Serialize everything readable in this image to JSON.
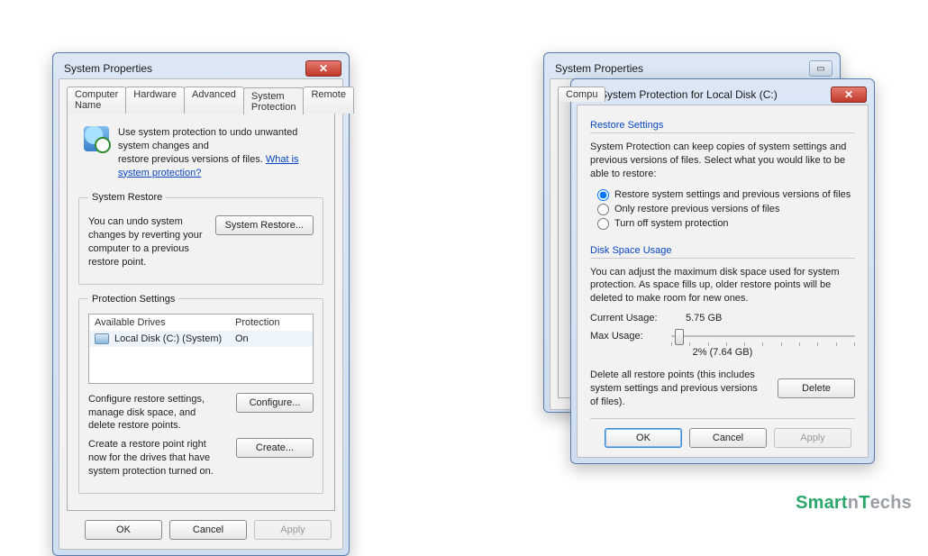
{
  "brand": {
    "part1": "Smart",
    "part2": "n",
    "part3": "T",
    "part4": "echs"
  },
  "win1": {
    "title": "System Properties",
    "tabs": [
      "Computer Name",
      "Hardware",
      "Advanced",
      "System Protection",
      "Remote"
    ],
    "activeTabIndex": 3,
    "intro_line1": "Use system protection to undo unwanted system changes and",
    "intro_line2_pre": "restore previous versions of files. ",
    "intro_link": "What is system protection?",
    "group_restore_title": "System Restore",
    "restore_desc": "You can undo system changes by reverting your computer to a previous restore point.",
    "restore_btn": "System Restore...",
    "group_protection_title": "Protection Settings",
    "col_drive": "Available Drives",
    "col_protection": "Protection",
    "drive_row": {
      "name": "Local Disk (C:) (System)",
      "status": "On"
    },
    "configure_desc": "Configure restore settings, manage disk space, and delete restore points.",
    "configure_btn": "Configure...",
    "create_desc": "Create a restore point right now for the drives that have system protection turned on.",
    "create_btn": "Create...",
    "ok": "OK",
    "cancel": "Cancel",
    "apply": "Apply"
  },
  "win2_back": {
    "title": "System Properties",
    "tab_visible": "Compu"
  },
  "win2": {
    "title": "System Protection for Local Disk (C:)",
    "section_restore": "Restore Settings",
    "restore_desc": "System Protection can keep copies of system settings and previous versions of files. Select what you would like to be able to restore:",
    "opt1": "Restore system settings and previous versions of files",
    "opt2": "Only restore previous versions of files",
    "opt3": "Turn off system protection",
    "selected_option": 0,
    "section_disk": "Disk Space Usage",
    "disk_desc": "You can adjust the maximum disk space used for system protection. As space fills up, older restore points will be deleted to make room for new ones.",
    "current_label": "Current Usage:",
    "current_value": "5.75 GB",
    "max_label": "Max Usage:",
    "slider_percent": 2,
    "slider_text": "2% (7.64 GB)",
    "delete_desc": "Delete all restore points (this includes system settings and previous versions of files).",
    "delete_btn": "Delete",
    "ok": "OK",
    "cancel": "Cancel",
    "apply": "Apply"
  }
}
